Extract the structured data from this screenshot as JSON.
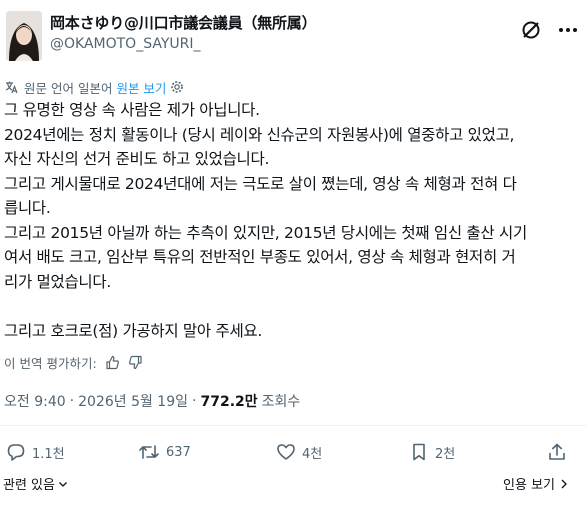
{
  "author": {
    "name": "岡本さゆり@川口市議会議員（無所属）",
    "handle": "@OKAMOTO_SAYURI_"
  },
  "translation": {
    "label": "원문 언어 일본어",
    "show_original": "원본 보기"
  },
  "tweet_lines": [
    "그 유명한 영상 속 사람은 제가 아닙니다.",
    "2024년에는 정치 활동이나 (당시 레이와 신슈군의 자원봉사)에 열중하고 있었고,",
    "자신 자신의 선거 준비도 하고 있었습니다.",
    "그리고 게시물대로 2024년대에 저는 극도로 살이 쪘는데, 영상 속 체형과 전혀 다",
    "릅니다.",
    "그리고 2015년 아닐까 하는 추측이 있지만, 2015년 당시에는 첫째 임신 출산 시기",
    "여서 배도 크고, 임산부 특유의 전반적인 부종도 있어서, 영상 속 체형과 현저히 거",
    "리가 멀었습니다.",
    "",
    "그리고 호크로(점) 가공하지 말아 주세요."
  ],
  "rate_translation": "이 번역 평가하기:",
  "meta": {
    "time": "오전 9:40",
    "separator": "·",
    "date": "2026년 5월 19일",
    "views_count": "772.2만",
    "views_label": "조회수"
  },
  "actions": {
    "replies": "1.1천",
    "reposts": "637",
    "likes": "4천",
    "bookmarks": "2천"
  },
  "footer": {
    "related": "관련 있음",
    "quotes": "인용 보기"
  },
  "colors": {
    "text": "#0f1419",
    "secondary": "#536471",
    "link": "#1d9bf0",
    "divider": "#eff3f4"
  }
}
